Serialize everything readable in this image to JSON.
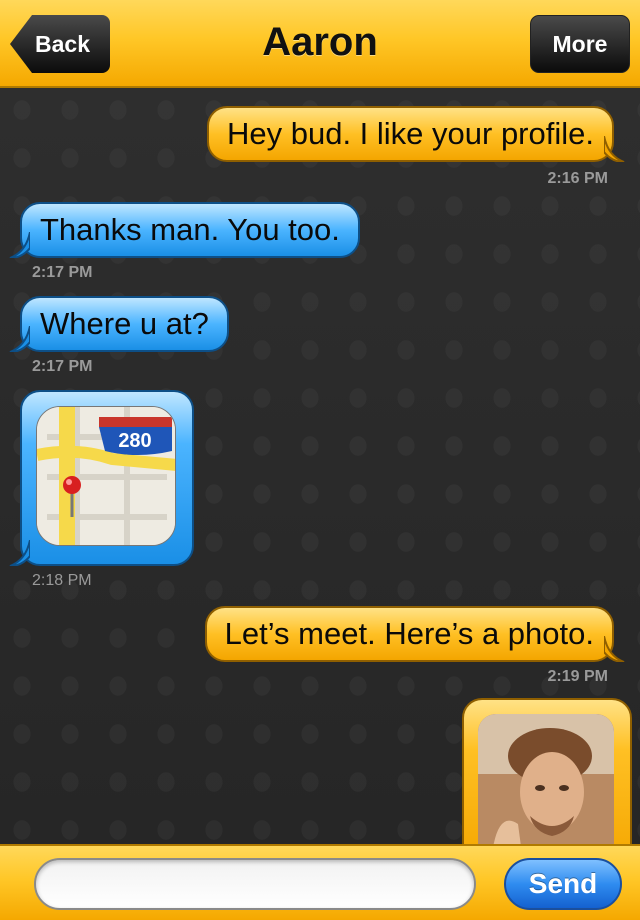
{
  "header": {
    "title": "Aaron",
    "back_label": "Back",
    "more_label": "More"
  },
  "messages": [
    {
      "direction": "out",
      "type": "text",
      "text": "Hey bud. I like your profile.",
      "time": "2:16 PM"
    },
    {
      "direction": "in",
      "type": "text",
      "text": "Thanks man. You too.",
      "time": "2:17 PM"
    },
    {
      "direction": "in",
      "type": "text",
      "text": "Where u at?",
      "time": "2:17 PM"
    },
    {
      "direction": "in",
      "type": "location",
      "map_label": "280",
      "time": "2:18 PM"
    },
    {
      "direction": "out",
      "type": "text",
      "text": "Let’s meet. Here’s a photo.",
      "time": "2:19 PM"
    },
    {
      "direction": "out",
      "type": "photo"
    }
  ],
  "composer": {
    "input_value": "",
    "placeholder": "",
    "send_label": "Send"
  },
  "colors": {
    "accent_yellow": "#ffc727",
    "incoming_blue": "#4bb4ff",
    "send_blue": "#2f8cf0",
    "background": "#2b2b2b"
  },
  "icons": [
    "back-chevron-icon",
    "map-pin-icon"
  ]
}
